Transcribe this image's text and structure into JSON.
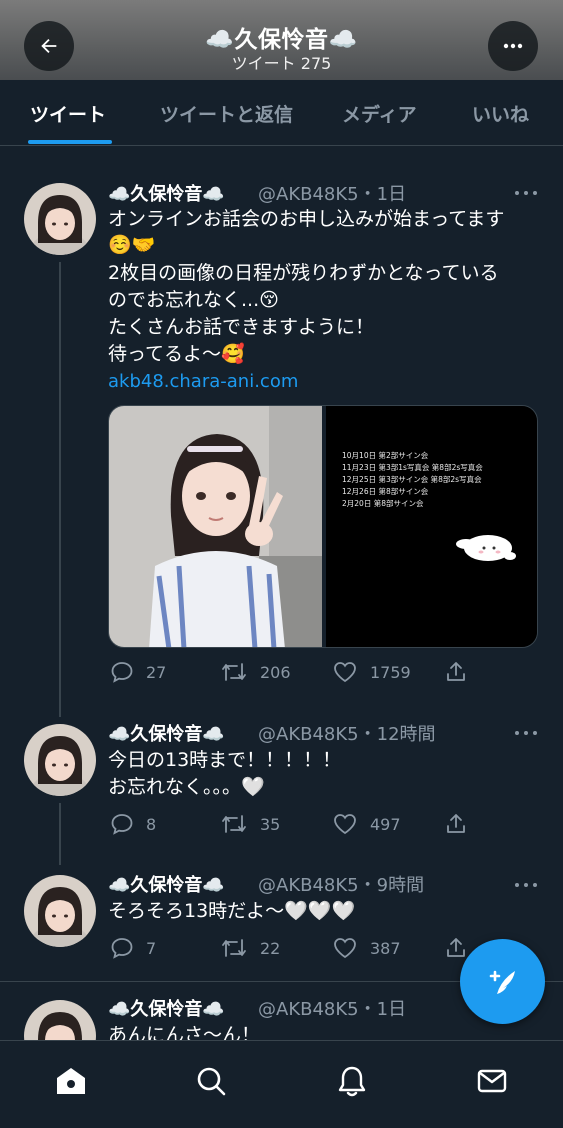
{
  "header": {
    "title": "☁️久保怜音☁️",
    "tweet_count": "ツイート 275",
    "back_icon": "arrow-left-icon",
    "more_icon": "more-horizontal-icon"
  },
  "tabs": [
    {
      "label": "ツイート",
      "active": true
    },
    {
      "label": "ツイートと返信",
      "active": false
    },
    {
      "label": "メディア",
      "active": false
    },
    {
      "label": "いいね",
      "active": false
    }
  ],
  "tweets": [
    {
      "name": "☁️久保怜音☁️",
      "meta": "@AKB48K5・1日",
      "lines": [
        "オンラインお話会のお申し込みが始まってます",
        "☺️🤝",
        "2枚目の画像の日程が残りわずかとなっている",
        "のでお忘れなく...😚",
        "たくさんお話できますように！",
        "待ってるよ〜🥰"
      ],
      "link": "akb48.chara-ani.com",
      "schedule": [
        "10月10日 第2部サイン会",
        "11月23日 第3部1s写真会 第8部2s写真会",
        "12月25日 第3部サイン会 第8部2s写真会",
        "12月26日 第8部サイン会",
        "2月20日 第8部サイン会"
      ],
      "replies": "27",
      "retweets": "206",
      "likes": "1759"
    },
    {
      "name": "☁️久保怜音☁️",
      "meta": "@AKB48K5・12時間",
      "lines": [
        "今日の13時まで！！！！！",
        "お忘れなく。。。🤍"
      ],
      "replies": "8",
      "retweets": "35",
      "likes": "497"
    },
    {
      "name": "☁️久保怜音☁️",
      "meta": "@AKB48K5・9時間",
      "lines": [
        "そろそろ13時だよ〜🤍🤍🤍"
      ],
      "replies": "7",
      "retweets": "22",
      "likes": "387"
    },
    {
      "name": "☁️久保怜音☁️",
      "meta": "@AKB48K5・1日",
      "lines": [
        "あんにんさ〜ん！"
      ]
    }
  ],
  "colors": {
    "background": "#15202b",
    "accent": "#1d9bf0",
    "muted": "#8b98a5",
    "divider": "#38444d"
  },
  "bottom_nav": [
    "home-icon",
    "search-icon",
    "notifications-icon",
    "messages-icon"
  ],
  "fab_icon": "compose-tweet-icon"
}
